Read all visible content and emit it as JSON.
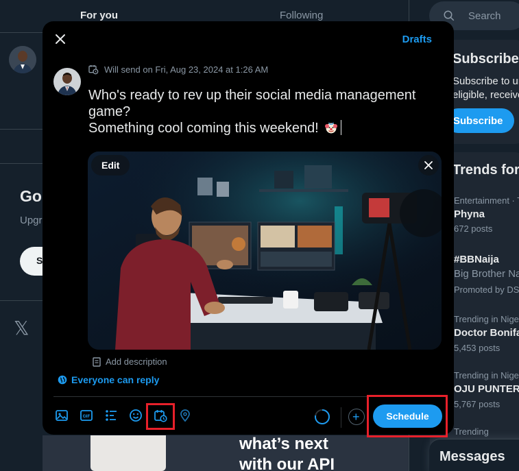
{
  "background": {
    "tabs": {
      "for_you": "For you",
      "following": "Following"
    },
    "go_title": "Go",
    "upgrade_text": "Upgr",
    "pill_label": "S",
    "x_logo": "𝕏",
    "promo_text_line1": "what’s next",
    "promo_text_line2": "with our API"
  },
  "right_column": {
    "search_placeholder": "Search",
    "subscribe": {
      "title": "Subscribe to",
      "text_line1": "Subscribe to unlo",
      "text_line2": "eligible, receive a",
      "button": "Subscribe"
    },
    "trends_title": "Trends for y",
    "trends": [
      {
        "meta": "Entertainment · Tre",
        "name": "Phyna",
        "posts": "672 posts"
      },
      {
        "meta": "",
        "name": "#BBNaija",
        "posts": "Big Brother Naija",
        "promoted": "Promoted by DS"
      },
      {
        "meta": "Trending in Nigeria",
        "name": "Doctor Boniface",
        "posts": "5,453 posts"
      },
      {
        "meta": "Trending in Nigeria",
        "name": "OJU PUNTER",
        "posts": "5,767 posts"
      },
      {
        "meta": "Trending",
        "name": "",
        "posts": ""
      }
    ],
    "messages": "Messages"
  },
  "modal": {
    "drafts": "Drafts",
    "schedule_info": "Will send on Fri, Aug 23, 2024 at 1:26 AM",
    "text_line1": "Who's ready to rev up their social media management",
    "text_line2": "game?",
    "text_line3": "Something cool coming this weekend!",
    "media_edit": "Edit",
    "add_description": "Add description",
    "reply_setting": "Everyone can reply",
    "schedule_button": "Schedule",
    "toolbar_icons": [
      "image-icon",
      "gif-icon",
      "poll-icon",
      "emoji-icon",
      "schedule-icon",
      "location-icon"
    ]
  },
  "colors": {
    "accent": "#1d9bf0",
    "background": "#15202b",
    "modal": "#000000",
    "highlight": "#e8202a"
  }
}
